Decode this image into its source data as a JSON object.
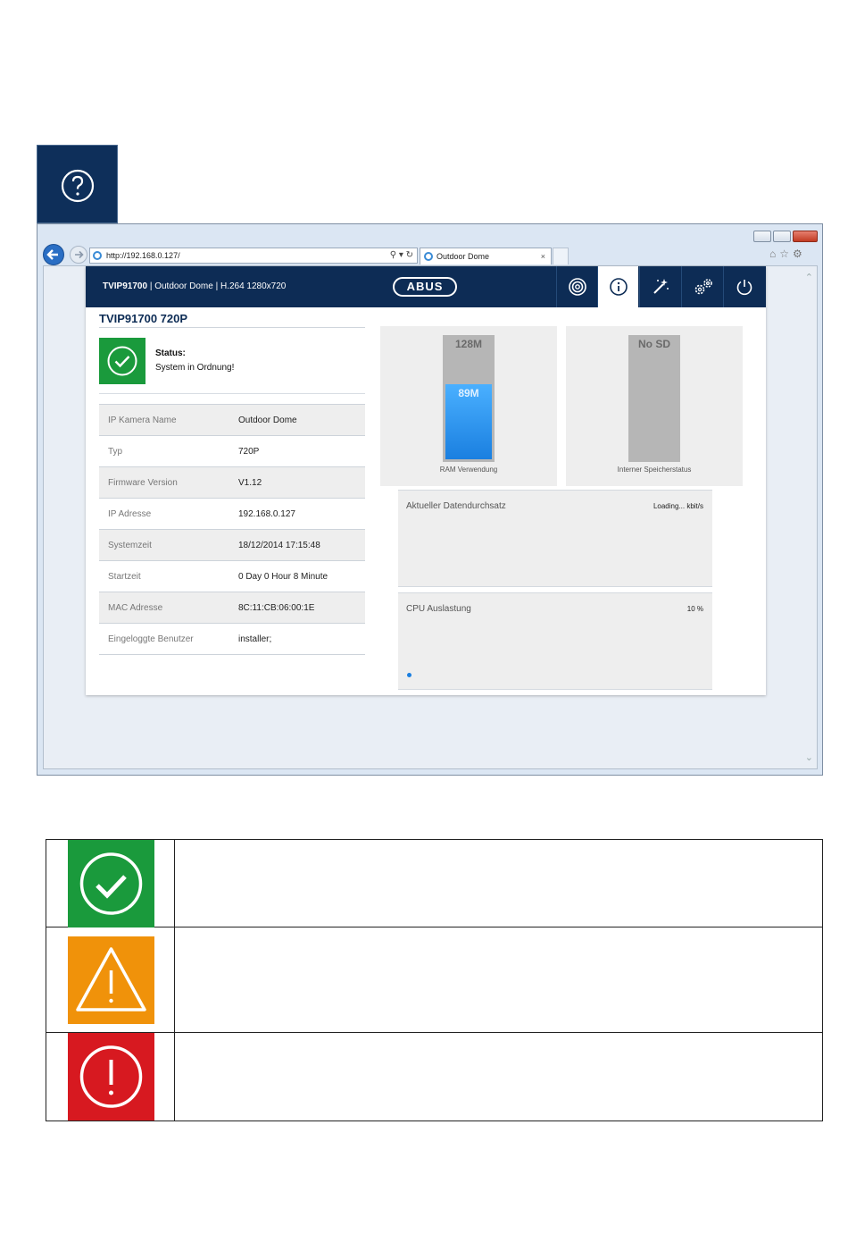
{
  "browser": {
    "url": "http://192.168.0.127/",
    "tab_title": "Outdoor Dome",
    "tab_close": "×",
    "addr_controls": "⚲ ▾ ↻",
    "toolbar_icons": "⌂☆⚙",
    "scroll_up": "⌃",
    "scroll_down": "⌄"
  },
  "app": {
    "header_model": "TVIP91700",
    "header_rest": " | Outdoor Dome | H.264 1280x720",
    "logo": "ABUS",
    "device_title": "TVIP91700 720P",
    "status": {
      "label": "Status:",
      "text": "System in Ordnung!",
      "color": "#1a9a3c"
    },
    "info_rows": [
      {
        "key": "IP Kamera Name",
        "value": "Outdoor Dome"
      },
      {
        "key": "Typ",
        "value": "720P"
      },
      {
        "key": "Firmware Version",
        "value": "V1.12"
      },
      {
        "key": "IP Adresse",
        "value": "192.168.0.127"
      },
      {
        "key": "Systemzeit",
        "value": "18/12/2014 17:15:48"
      },
      {
        "key": "Startzeit",
        "value": "0 Day 0 Hour 8 Minute"
      },
      {
        "key": "MAC Adresse",
        "value": "8C:11:CB:06:00:1E"
      },
      {
        "key": "Eingeloggte Benutzer",
        "value": "installer;"
      }
    ],
    "ram": {
      "max": "128M",
      "used": "89M",
      "used_fraction": 0.62,
      "caption": "RAM Verwendung"
    },
    "storage": {
      "max": "No SD",
      "caption": "Interner Speicherstatus"
    },
    "throughput": {
      "label": "Aktueller Datendurchsatz",
      "value": "Loading... kbit/s"
    },
    "cpu": {
      "label": "CPU Auslastung",
      "value": "10 %"
    }
  },
  "colors": {
    "header_bg": "#0d2c55",
    "ok": "#1a9a3c",
    "warning": "#f0920a",
    "error": "#d71920"
  },
  "legend": [
    {
      "icon": "check-circle-icon",
      "color": "#1a9a3c",
      "text": ""
    },
    {
      "icon": "warning-triangle-icon",
      "color": "#f0920a",
      "text": ""
    },
    {
      "icon": "error-circle-icon",
      "color": "#d71920",
      "text": ""
    }
  ]
}
